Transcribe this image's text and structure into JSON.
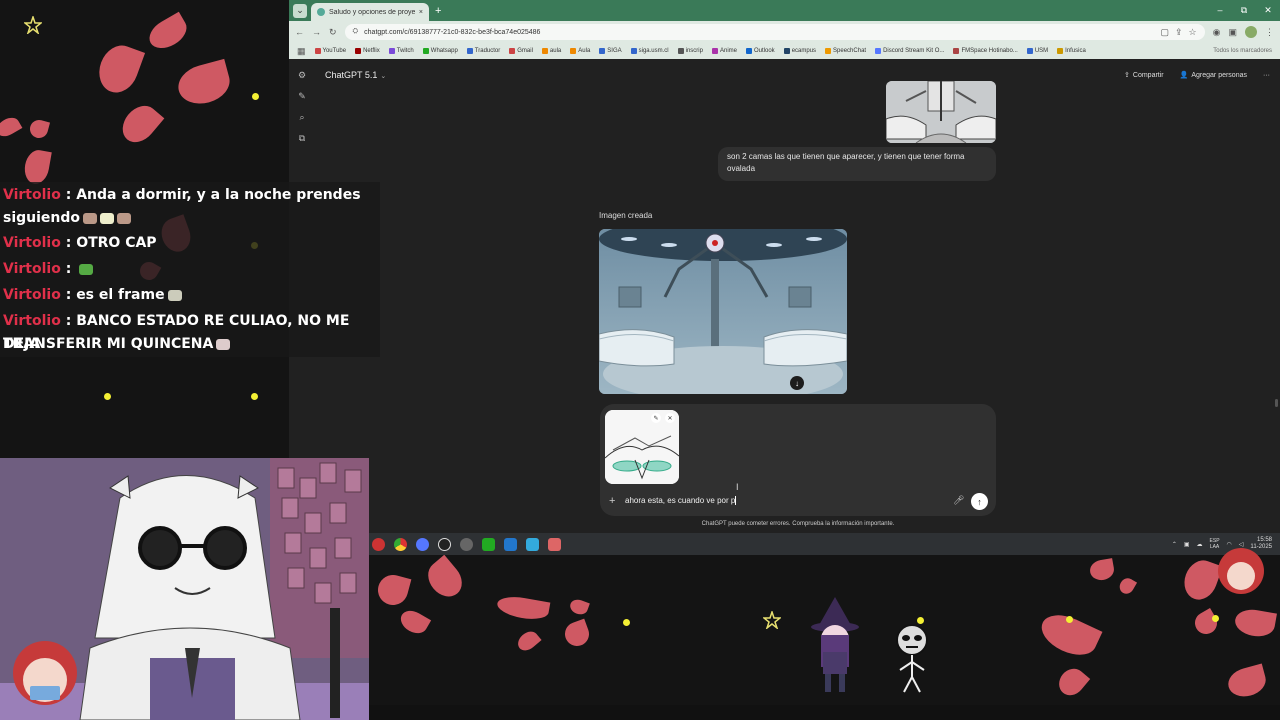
{
  "browser": {
    "tab_title": "Saludo y opciones de proyecto",
    "tab_close": "×",
    "new_tab": "+",
    "url": "chatgpt.com/c/69138777-21c0-832c-be3f-bca74e025486",
    "bookmarks": [
      "YouTube",
      "Netflix",
      "Twitch",
      "Whatsapp",
      "Traductor",
      "Gmail",
      "aula",
      "Aula",
      "SIGA",
      "siga.usm.cl",
      "inscrip",
      "Anime",
      "Outlook",
      "ecampus",
      "SpeechChat",
      "Discord Stream Kit O...",
      "FMSpace Hotinabo...",
      "USM",
      "Infusica"
    ],
    "all_bookmarks": "Todos los marcadores",
    "window_controls": [
      "–",
      "⧉",
      "✕"
    ]
  },
  "chatgpt": {
    "model": "ChatGPT 5.1",
    "share_label": "Compartir",
    "add_people_label": "Agregar personas",
    "more_label": "···",
    "user_message": "son 2 camas las que tienen que aparecer, y tienen que tener forma ovalada",
    "image_created_label": "Imagen creada",
    "input_text": "ahora esta, es cuando ve por p",
    "disclaimer": "ChatGPT puede cometer errores. Comprueba la información importante."
  },
  "taskbar": {
    "lang_top": "ESP",
    "lang_bottom": "LAA",
    "time": "15:58",
    "date": "11-2025"
  },
  "stream_chat": [
    {
      "user": "Virtolio",
      "text": "Anda a dormir, y a la noche prendes",
      "cont": "siguiendo"
    },
    {
      "user": "Virtolio",
      "text": "OTRO CAP"
    },
    {
      "user": "Virtolio",
      "text": ""
    },
    {
      "user": "Virtolio",
      "text": "es el frame"
    },
    {
      "user": "Virtolio",
      "text": "BANCO ESTADO RE CULIAO, NO ME DEJA",
      "cont": "TRANSFERIR MI QUINCENA"
    }
  ],
  "colors": {
    "petal": "#e0606a",
    "chat_user": "#e0304a",
    "browser_accent": "#3a7a58",
    "chatgpt_bg": "#212121"
  },
  "icons": [
    "new-chat-icon",
    "search-icon",
    "library-icon",
    "share-icon",
    "add-person-icon",
    "download-icon",
    "plus-icon",
    "mic-icon",
    "send-arrow-icon",
    "star-icon"
  ]
}
